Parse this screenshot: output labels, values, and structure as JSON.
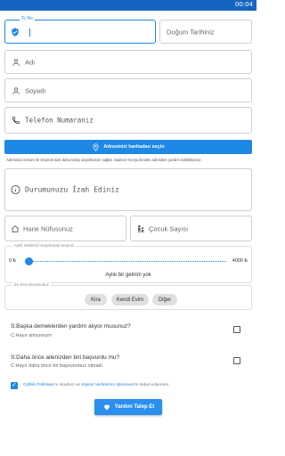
{
  "status_bar": {
    "time": "00:04",
    "color": "#1565c0"
  },
  "form": {
    "tc_no": {
      "label": "Tc No",
      "value": "",
      "icon": "shield-check-icon"
    },
    "birth_date": {
      "placeholder": "Doğum Tarihiniz"
    },
    "first_name": {
      "placeholder": "Adı",
      "icon": "person-icon"
    },
    "last_name": {
      "placeholder": "Soyadı",
      "icon": "person-icon"
    },
    "phone": {
      "placeholder": "Telefon Numaranız",
      "icon": "phone-icon"
    },
    "map_button": {
      "label": "Adresinizi haritadan seçin",
      "icon": "add-location-icon"
    },
    "map_note": "Adresinizi konum ile seçmek size daha kolay ulaşılmasını sağlar. Sadece Konya ilindeki adreslere yardım edebiliyoruz.",
    "situation": {
      "placeholder": "Durumunuzu İzah Ediniz",
      "icon": "info-icon"
    },
    "household": {
      "placeholder": "Hane Nüfusunuz",
      "icon": "home-icon"
    },
    "children": {
      "placeholder": "Çocuk Sayısı",
      "icon": "family-icon"
    },
    "income": {
      "legend": "Aylık Gelirinizi Kaydırarak Seçiniz",
      "min_label": "0 ₺",
      "max_label": "4000 ₺",
      "min": 0,
      "max": 4000,
      "value": 0,
      "value_text": "Aylık bir gelirim yok"
    },
    "housing": {
      "legend": "Ev Kira Durumunuz",
      "options": [
        "Kira",
        "Kendi Evim",
        "Diğer"
      ]
    },
    "questions": [
      {
        "question": "S:Başka demeklerden yardım alıyor musunuz?",
        "answer": "C:Hayır almıyorum",
        "checked": false
      },
      {
        "question": "S:Daha önce ailenizden biri başvurdu mu?",
        "answer": "C:Hayır daha önce bir başvurumuz olmadı",
        "checked": false
      }
    ],
    "consent": {
      "checked": true,
      "link1": "Gizlilik Politikası",
      "part1": "'nı okudum ve",
      "link2": "Kişisel Verilerimin İşlenmesi",
      "part2": "'ni kabul ediyorum."
    },
    "submit_button": {
      "label": "Yardım Talep Et",
      "icon": "heart-hand-icon"
    }
  },
  "colors": {
    "accent": "#1e88e5",
    "chip": "#e0e0e0"
  }
}
